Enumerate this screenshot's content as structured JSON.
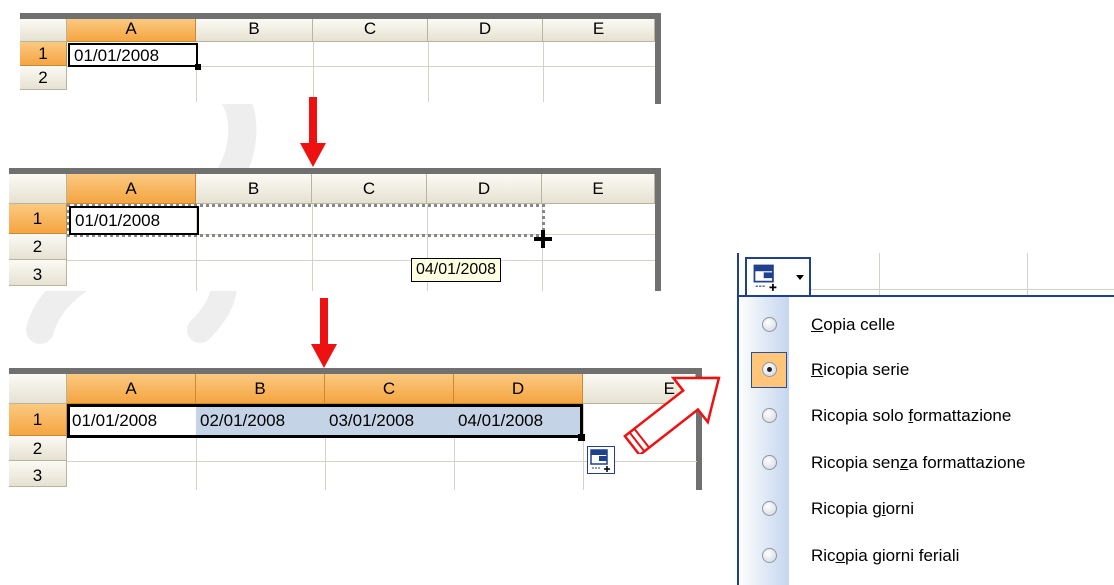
{
  "columns": [
    "A",
    "B",
    "C",
    "D",
    "E"
  ],
  "rows": [
    "1",
    "2",
    "3"
  ],
  "sheet1": {
    "a1": "01/01/2008"
  },
  "sheet2": {
    "a1": "01/01/2008",
    "tooltip": "04/01/2008"
  },
  "sheet3": {
    "cells": [
      "01/01/2008",
      "02/01/2008",
      "03/01/2008",
      "04/01/2008"
    ]
  },
  "menu": {
    "options": [
      {
        "pre": "",
        "ul": "C",
        "post": "opia celle",
        "selected": false
      },
      {
        "pre": "",
        "ul": "R",
        "post": "icopia serie",
        "selected": true
      },
      {
        "pre": "Ricopia solo ",
        "ul": "f",
        "post": "ormattazione",
        "selected": false
      },
      {
        "pre": "Ricopia sen",
        "ul": "z",
        "post": "a formattazione",
        "selected": false
      },
      {
        "pre": "Ricopia g",
        "ul": "i",
        "post": "orni",
        "selected": false
      },
      {
        "pre": "Ric",
        "ul": "o",
        "post": "pia giorni feriali",
        "selected": false
      }
    ]
  },
  "colors": {
    "selected_header": "#f5a541",
    "fill_selection": "#c5d3e6",
    "arrow": "#ee1111"
  }
}
